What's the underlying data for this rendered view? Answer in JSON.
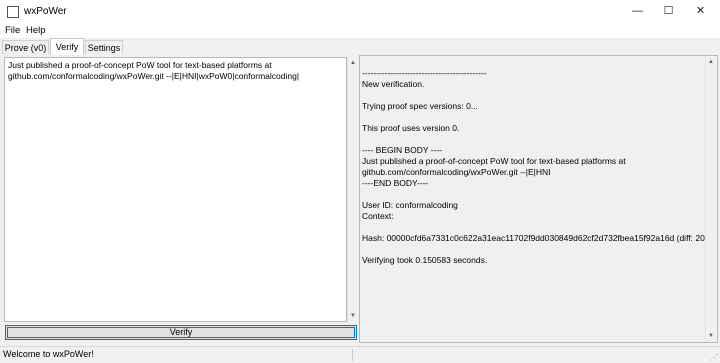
{
  "window": {
    "title": "wxPoWer",
    "minimize_glyph": "—",
    "maximize_glyph": "☐",
    "close_glyph": "✕"
  },
  "menu": [
    "File",
    "Help"
  ],
  "tabs": [
    {
      "label": "Prove (v0)",
      "active": false
    },
    {
      "label": "Verify",
      "active": true
    },
    {
      "label": "Settings",
      "active": false
    }
  ],
  "verify": {
    "input_text": "Just published a proof-of-concept PoW tool for text-based platforms at\ngithub.com/conformalcoding/wxPoWer.git --|E|HNI|wxPoW0|conformalcoding|",
    "button_label": "Verify"
  },
  "output_lines": [
    "--------------------------------------------",
    "New verification.",
    "",
    "Trying proof spec versions: 0...",
    "",
    "This proof uses version 0.",
    "",
    "---- BEGIN BODY ----",
    "Just published a proof-of-concept PoW tool for text-based platforms at",
    "github.com/conformalcoding/wxPoWer.git --|E|HNI",
    "----END BODY----",
    "",
    "User ID: conformalcoding",
    "Context:",
    "",
    "Hash: 00000cfd6a7331c0c622a31eac11702f9dd030849d62cf2d732fbea15f92a16d (diff: 20)",
    "",
    "Verifying took 0.150583 seconds."
  ],
  "status": {
    "text": "Welcome to wxPoWer!"
  }
}
